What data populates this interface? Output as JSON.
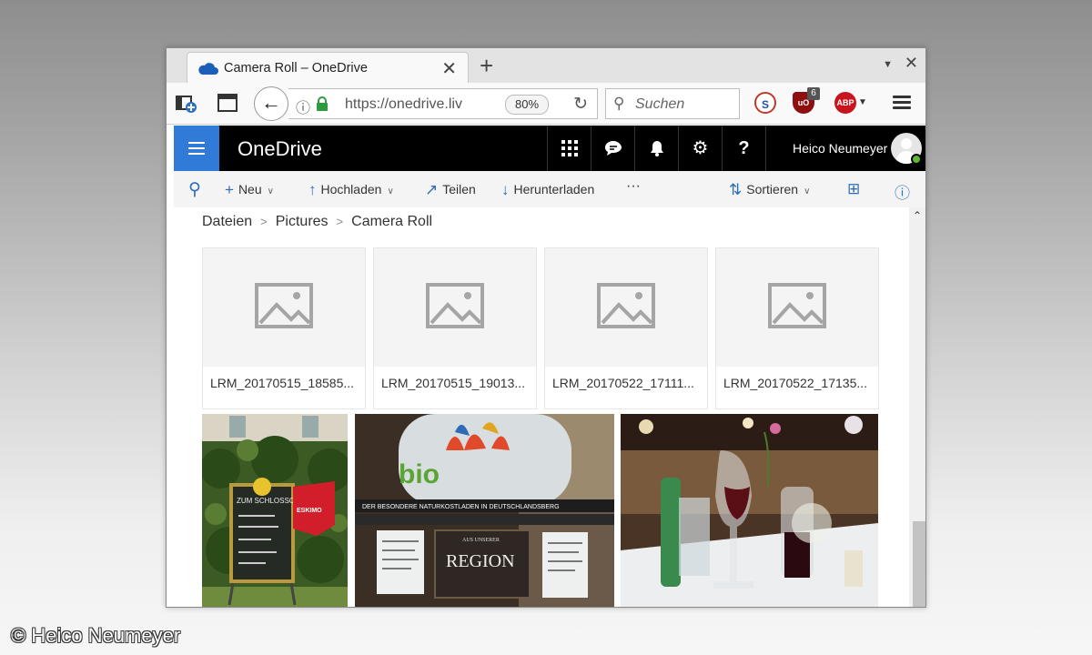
{
  "browser": {
    "tab_title": "Camera Roll – OneDrive",
    "url": "https://onedrive.liv",
    "zoom": "80%",
    "search_placeholder": "Suchen",
    "extension_badge": "6",
    "ext_s_label": "S",
    "ext_ublock_label": "uO",
    "ext_abp_label": "ABP"
  },
  "onedrive": {
    "brand": "OneDrive",
    "user_name": "Heico Neumeyer"
  },
  "commands": {
    "new": "Neu",
    "upload": "Hochladen",
    "share": "Teilen",
    "download": "Herunterladen",
    "more": "···",
    "sort": "Sortieren"
  },
  "breadcrumb": [
    "Dateien",
    "Pictures",
    "Camera Roll"
  ],
  "files": [
    "LRM_20170515_18585...",
    "LRM_20170515_19013...",
    "LRM_20170522_17111...",
    "LRM_20170522_17135..."
  ],
  "photos": {
    "sign_text": "ZUM SCHLOSSCAFÉ",
    "eskimo": "ESKIMO",
    "bio_word": "bio",
    "store_banner": "DER BESONDERE NATURKOSTLADEN IN DEUTSCHLANDSBERG",
    "region": "REGION",
    "region_top": "AUS UNSERER"
  },
  "watermark": "© Heico Neumeyer"
}
